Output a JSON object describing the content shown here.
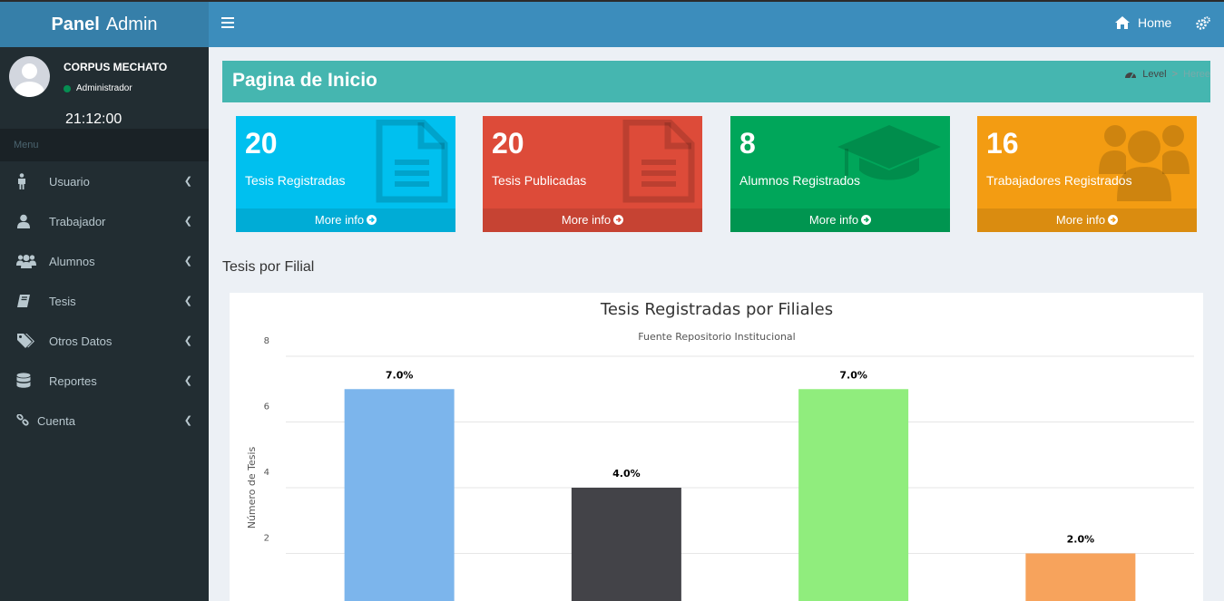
{
  "brand": {
    "bold": "Panel",
    "light": "Admin"
  },
  "topnav": {
    "home_label": "Home"
  },
  "user": {
    "name": "CORPUS MECHATO",
    "role": "Administrador",
    "clock": "21:12:00"
  },
  "sidebar": {
    "header": "Menu",
    "items": [
      {
        "label": "Usuario",
        "icon": "male-icon"
      },
      {
        "label": "Trabajador",
        "icon": "user-icon"
      },
      {
        "label": "Alumnos",
        "icon": "users-icon"
      },
      {
        "label": "Tesis",
        "icon": "book-icon"
      },
      {
        "label": "Otros Datos",
        "icon": "tags-icon"
      },
      {
        "label": "Reportes",
        "icon": "database-icon"
      },
      {
        "label": "Cuenta",
        "icon": "link-icon"
      }
    ]
  },
  "page": {
    "title": "Pagina de Inicio",
    "breadcrumb": {
      "level": "Level",
      "separator": ">",
      "current": "Heree"
    }
  },
  "boxes": [
    {
      "number": "20",
      "label": "Tesis Registradas",
      "more": "More info",
      "color": "#00c0ef",
      "icon": "file-text-icon"
    },
    {
      "number": "20",
      "label": "Tesis Publicadas",
      "more": "More info",
      "color": "#dd4b39",
      "icon": "file-text-icon"
    },
    {
      "number": "8",
      "label": "Alumnos Registrados",
      "more": "More info",
      "color": "#00a65a",
      "icon": "graduation-cap-icon"
    },
    {
      "number": "16",
      "label": "Trabajadores Registrados",
      "more": "More info",
      "color": "#f39c12",
      "icon": "users-icon"
    }
  ],
  "section_title": "Tesis por Filial",
  "chart_data": {
    "type": "bar",
    "title": "Tesis Registradas por Filiales",
    "subtitle": "Fuente Repositorio Institucional",
    "ylabel": "Número de Tesis",
    "ylim": [
      0,
      8
    ],
    "yticks": [
      2,
      4,
      6,
      8
    ],
    "values": [
      7,
      4,
      7,
      2
    ],
    "data_labels": [
      "7.0%",
      "4.0%",
      "7.0%",
      "2.0%"
    ],
    "colors": [
      "#7cb5ec",
      "#434348",
      "#90ed7d",
      "#f7a35c"
    ],
    "grid": true
  }
}
